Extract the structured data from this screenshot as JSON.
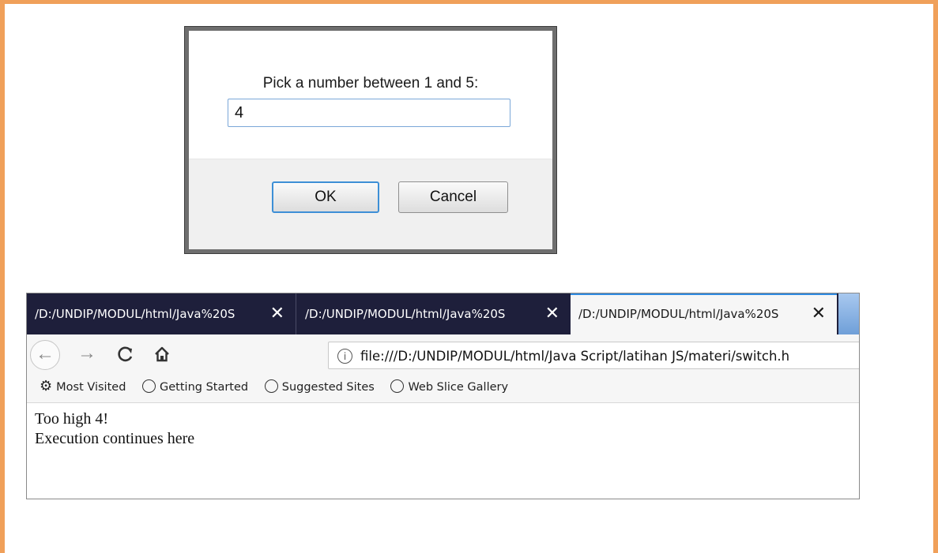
{
  "dialog": {
    "message": "Pick a number between 1 and 5:",
    "input_value": "4",
    "ok_label": "OK",
    "cancel_label": "Cancel"
  },
  "browser": {
    "tabs": [
      {
        "title": "/D:/UNDIP/MODUL/html/Java%20S",
        "close": "✕",
        "active": false
      },
      {
        "title": "/D:/UNDIP/MODUL/html/Java%20S",
        "close": "✕",
        "active": false
      },
      {
        "title": "/D:/UNDIP/MODUL/html/Java%20S",
        "close": "✕",
        "active": true
      }
    ],
    "nav": {
      "back_icon": "←",
      "forward_icon": "→",
      "reload_icon": "C",
      "home_icon": "⌂",
      "info_icon": "i",
      "url": "file:///D:/UNDIP/MODUL/html/Java Script/latihan JS/materi/switch.h"
    },
    "bookmarks": [
      {
        "label": "Most Visited",
        "icon": "gear-icon"
      },
      {
        "label": "Getting Started",
        "icon": "globe-icon"
      },
      {
        "label": "Suggested Sites",
        "icon": "globe-icon"
      },
      {
        "label": "Web Slice Gallery",
        "icon": "globe-icon"
      }
    ],
    "page_lines": [
      "Too high 4!",
      "Execution continues here"
    ]
  },
  "colors": {
    "frame": "#f0a05a",
    "tabbar": "#1e1f3b",
    "active_tab_accent": "#2f8ae0",
    "ok_button_border": "#3d8fd6"
  }
}
